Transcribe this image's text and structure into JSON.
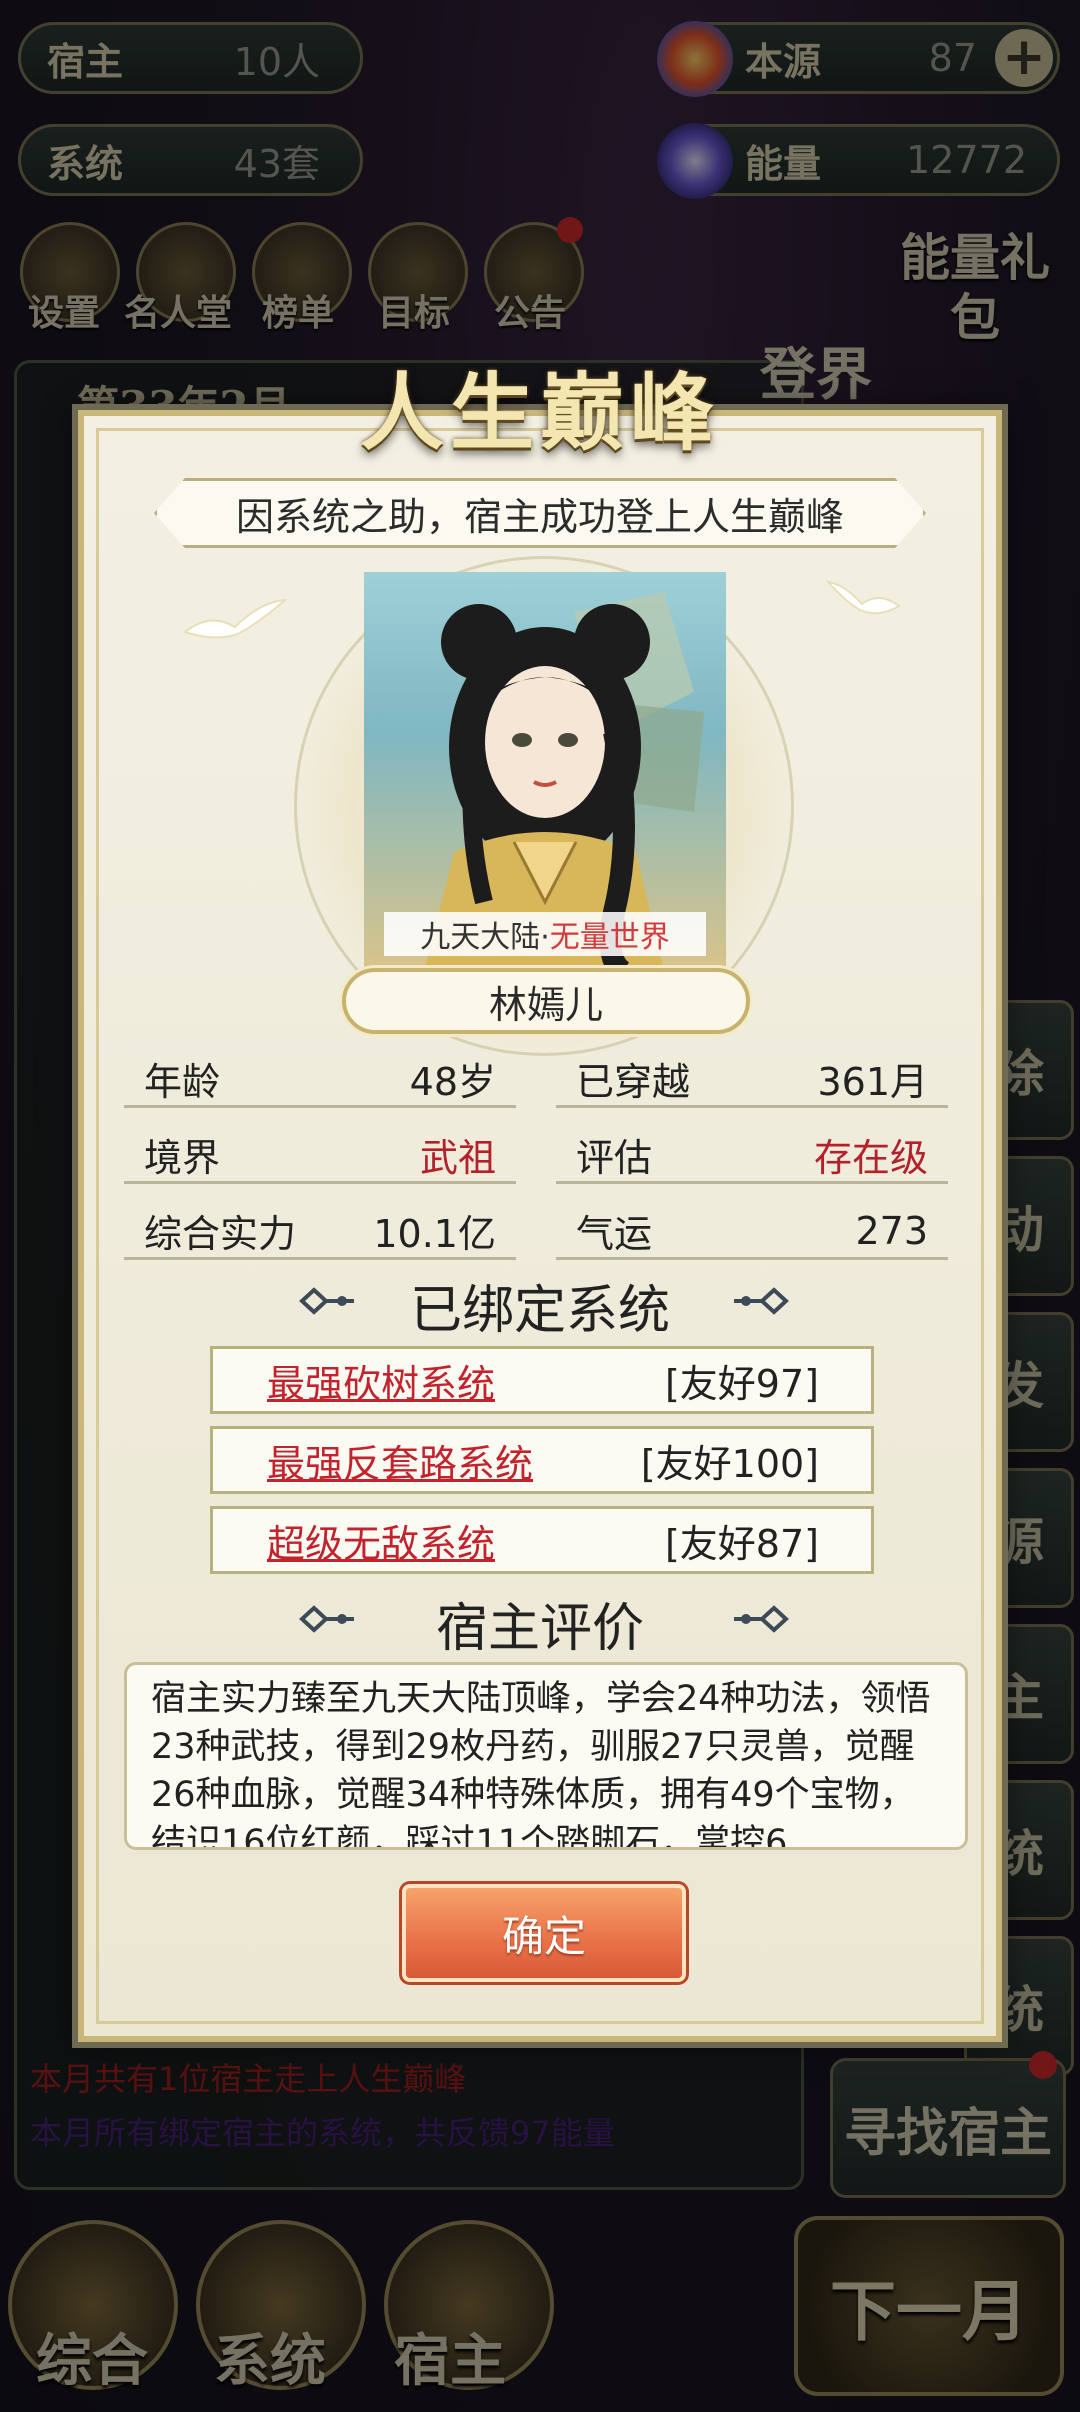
{
  "hud": {
    "hosts": {
      "label": "宿主",
      "value": "10人"
    },
    "systems": {
      "label": "系统",
      "value": "43套"
    },
    "origin": {
      "label": "本源",
      "value": "87"
    },
    "energy": {
      "label": "能量",
      "value": "12772"
    }
  },
  "top_menu": [
    "设置",
    "名人堂",
    "榜单",
    "目标",
    "公告"
  ],
  "energy_pack": "能量礼包",
  "timeline_header": "第33年2月",
  "login_world": "登界",
  "log_lines": [
    {
      "text": "本月共有1位宿主走上人生巅峰",
      "color": "#a01f1f"
    },
    {
      "text": "本月所有绑定宿主的系统，共反馈97能量",
      "color": "#4a1f7a"
    }
  ],
  "side_buttons": [
    "除",
    "动",
    "发",
    "源",
    "主",
    "统",
    "统"
  ],
  "find_host": "寻找宿主",
  "next_month": "下一月",
  "bottom_nav": [
    "综合",
    "系统",
    "宿主"
  ],
  "dialog": {
    "title": "人生巅峰",
    "subtitle": "因系统之助，宿主成功登上人生巅峰",
    "world_prefix": "九天大陆·",
    "world_accent": "无量世界",
    "host_name": "林嫣儿",
    "stats": [
      {
        "key": "年龄",
        "value": "48岁",
        "red": false
      },
      {
        "key": "已穿越",
        "value": "361月",
        "red": false
      },
      {
        "key": "境界",
        "value": "武祖",
        "red": true
      },
      {
        "key": "评估",
        "value": "存在级",
        "red": true
      },
      {
        "key": "综合实力",
        "value": "10.1亿",
        "red": false
      },
      {
        "key": "气运",
        "value": "273",
        "red": false
      }
    ],
    "bound_title": "已绑定系统",
    "systems": [
      {
        "name": "最强砍树系统",
        "friendship": "[友好97]"
      },
      {
        "name": "最强反套路系统",
        "friendship": "[友好100]"
      },
      {
        "name": "超级无敌系统",
        "friendship": "[友好87]"
      }
    ],
    "eval_title": "宿主评价",
    "eval_text": "宿主实力臻至九天大陆顶峰，学会24种功法，领悟23种武技，得到29枚丹药，驯服27只灵兽，觉醒26种血脉，觉醒34种特殊体质，拥有49个宝物，结识16位红颜，踩过11个踏脚石，掌控6",
    "confirm": "确定"
  },
  "colors": {
    "accent_red": "#b3212b",
    "button_orange": "#e97148",
    "frame_gold": "#c9b77a"
  }
}
